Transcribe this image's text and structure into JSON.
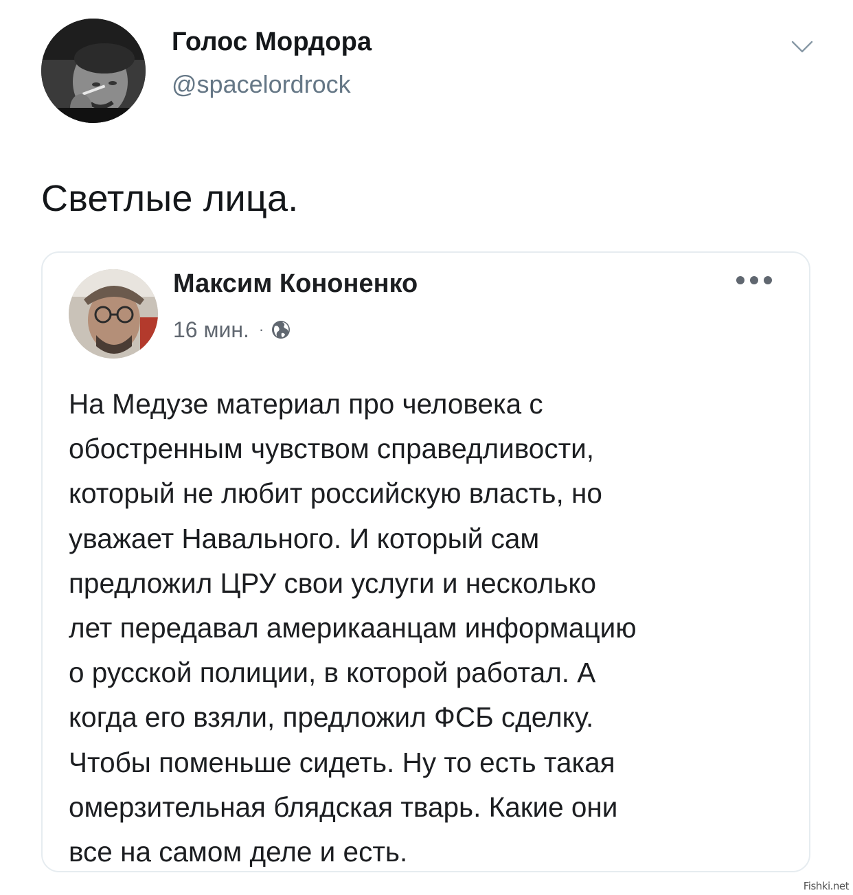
{
  "tweet": {
    "display_name": "Голос Мордора",
    "handle": "@spacelordrock",
    "text": "Светлые лица.",
    "menu_icon": "chevron-down-icon",
    "avatar_icon": "user-avatar"
  },
  "quoted_post": {
    "author": "Максим Кононенко",
    "time": "16 мин.",
    "separator": "·",
    "privacy_icon": "globe-icon",
    "more_icon": "more-dots-icon",
    "body": "На Медузе материал про человека с\nобостренным чувством справедливости,\nкоторый не любит российскую власть, но\nуважает Навального. И который сам\nпредложил ЦРУ свои услуги и несколько\nлет передавал америкаанцам информацию\nо русской полиции, в которой работал. А\nкогда его взяли, предложил ФСБ сделку.\nЧтобы поменьше сидеть. Ну то есть такая\nомерзительная блядская тварь. Какие они\nвсе на самом деле и есть."
  },
  "watermark": "Fishki.net",
  "colors": {
    "text_primary": "#14171a",
    "text_secondary": "#657786",
    "card_border": "#e6ecf0",
    "fb_meta": "#606770"
  }
}
